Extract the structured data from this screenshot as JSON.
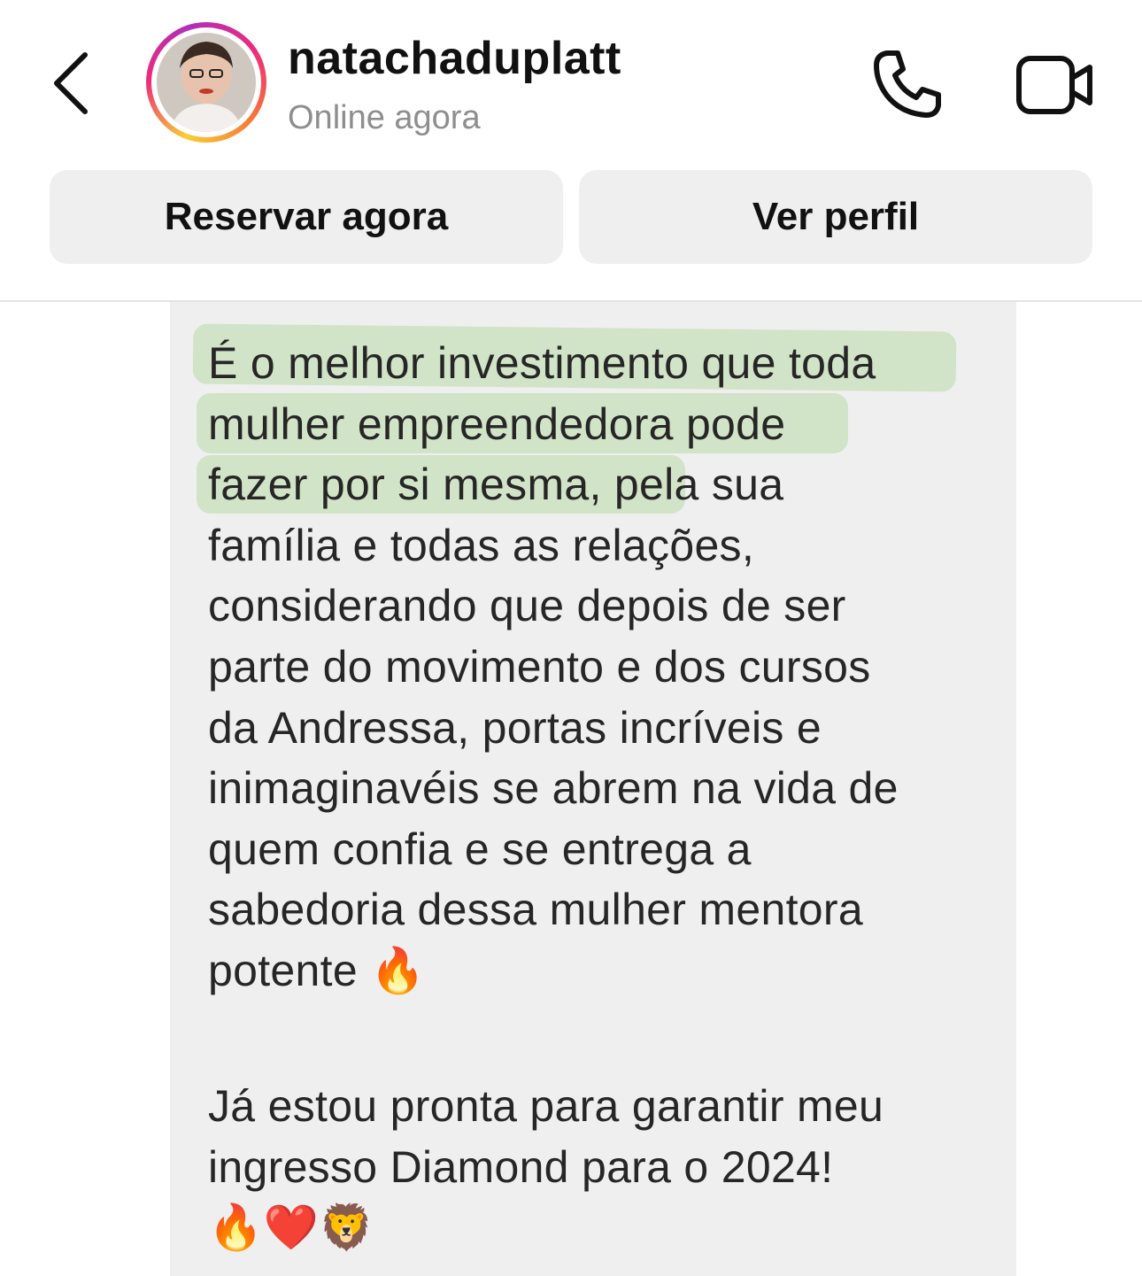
{
  "header": {
    "back_icon": "chevron-left-icon",
    "username": "natachaduplatt",
    "status": "Online agora",
    "call_icon": "phone-icon",
    "video_icon": "video-camera-icon"
  },
  "actions": {
    "reserve_label": "Reservar agora",
    "profile_label": "Ver perfil"
  },
  "message": {
    "paragraph1": "É o melhor investimento que toda\nmulher empreendedora pode\nfazer por si mesma, pela sua\nfamília e todas as relações,\nconsiderando que depois de ser\nparte do movimento e dos cursos\nda Andressa, portas incríveis e\ninimaginavéis se abrem na vida de\nquem confia e se entrega a\nsabedoria dessa mulher mentora\npotente 🔥",
    "paragraph2": "Já estou pronta para garantir meu\ningresso Diamond para o 2024!\n🔥❤️🦁"
  },
  "colors": {
    "bubble": "#efefef",
    "highlight": "#acd696",
    "status_text": "#8e8e8e"
  }
}
